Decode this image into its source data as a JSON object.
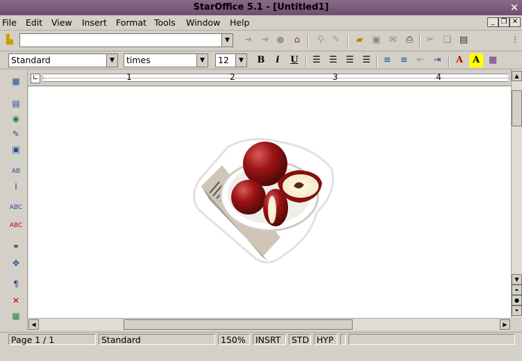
{
  "window": {
    "title": "StarOffice 5.1 - [Untitled1]"
  },
  "menu": {
    "items": [
      "File",
      "Edit",
      "View",
      "Insert",
      "Format",
      "Tools",
      "Window",
      "Help"
    ]
  },
  "format_bar": {
    "paragraph_style": "Standard",
    "font_name": "times",
    "font_size": "12",
    "bold_label": "B",
    "italic_label": "i",
    "underline_label": "U",
    "font_color_label": "A",
    "highlight_label": "A"
  },
  "ruler": {
    "marks": [
      "1",
      "2",
      "3",
      "4"
    ]
  },
  "status": {
    "page": "Page 1 / 1",
    "style": "Standard",
    "zoom": "150%",
    "insert_mode": "INSRT",
    "selection_mode": "STD",
    "hyphenation": "HYP"
  },
  "colors": {
    "titlebar": "#6e4f6e",
    "background": "#d4d0c8"
  }
}
